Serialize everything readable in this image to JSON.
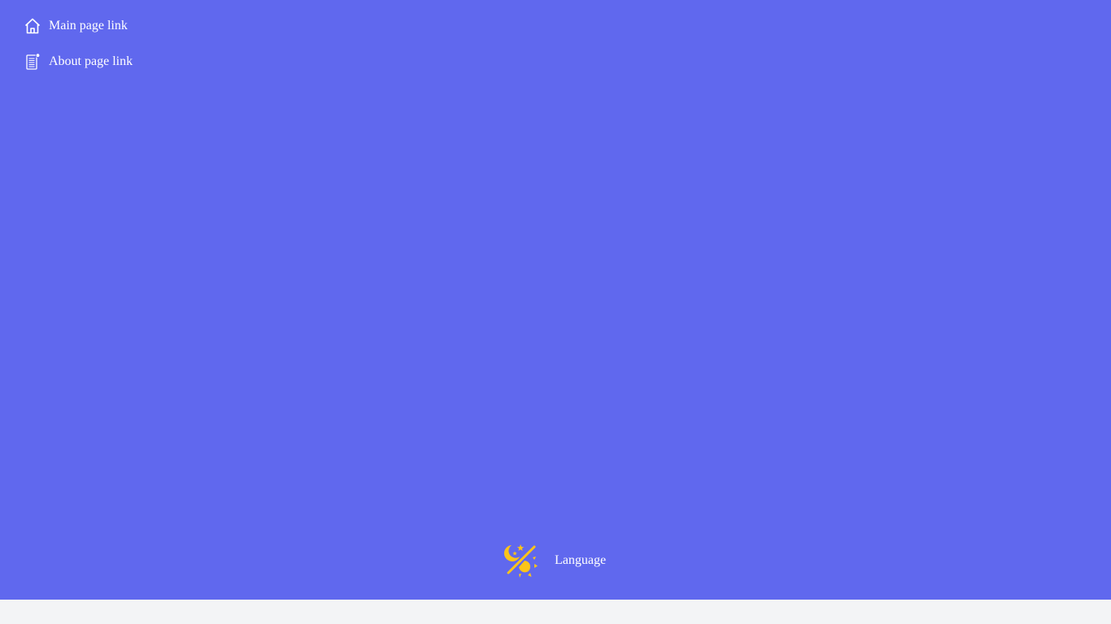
{
  "colors": {
    "panel_background": "#6068ee",
    "page_background": "#f3f4f6",
    "text": "#ffffff",
    "theme_icon": "#fcc419"
  },
  "nav": {
    "items": [
      {
        "label": "Main page link",
        "icon": "home-icon"
      },
      {
        "label": "About page link",
        "icon": "document-icon"
      }
    ]
  },
  "footer": {
    "theme_toggle_icon": "theme-toggle-icon",
    "language_label": "Language"
  }
}
